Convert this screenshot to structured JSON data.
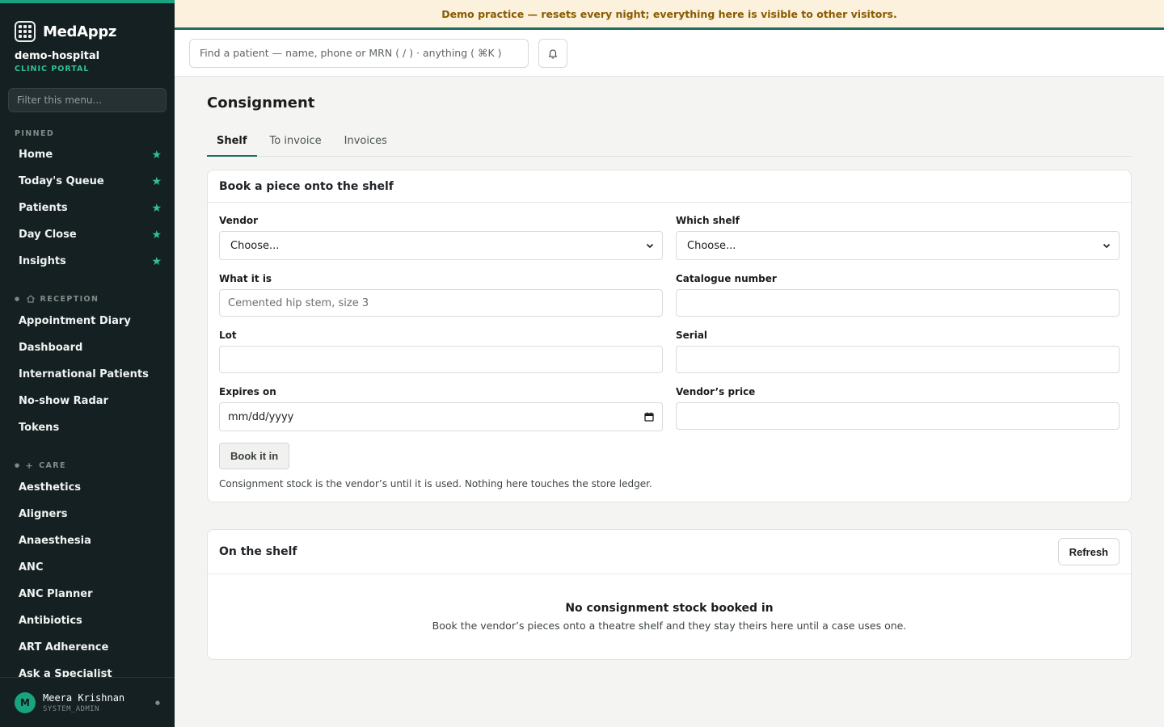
{
  "banner": {
    "text": "Demo practice — resets every night; everything here is visible to other visitors."
  },
  "sidebar": {
    "brand": "MedAppz",
    "tenant_name": "demo-hospital",
    "tenant_sub": "CLINIC PORTAL",
    "filter_placeholder": "Filter this menu...",
    "pinned_label": "PINNED",
    "pinned": [
      {
        "label": "Home"
      },
      {
        "label": "Today's Queue"
      },
      {
        "label": "Patients"
      },
      {
        "label": "Day Close"
      },
      {
        "label": "Insights"
      }
    ],
    "reception_label": "RECEPTION",
    "reception": [
      {
        "label": "Appointment Diary"
      },
      {
        "label": "Dashboard"
      },
      {
        "label": "International Patients"
      },
      {
        "label": "No-show Radar"
      },
      {
        "label": "Tokens"
      }
    ],
    "care_label": "CARE",
    "care": [
      {
        "label": "Aesthetics"
      },
      {
        "label": "Aligners"
      },
      {
        "label": "Anaesthesia"
      },
      {
        "label": "ANC"
      },
      {
        "label": "ANC Planner"
      },
      {
        "label": "Antibiotics"
      },
      {
        "label": "ART Adherence"
      },
      {
        "label": "Ask a Specialist"
      }
    ],
    "user": {
      "initial": "M",
      "name": "Meera Krishnan",
      "role": "SYSTEM_ADMIN"
    }
  },
  "topbar": {
    "search_placeholder": "Find a patient — name, phone or MRN ( / ) · anything ( ⌘K )"
  },
  "page": {
    "title": "Consignment",
    "tabs": [
      {
        "label": "Shelf"
      },
      {
        "label": "To invoice"
      },
      {
        "label": "Invoices"
      }
    ]
  },
  "form": {
    "title": "Book a piece onto the shelf",
    "vendor_label": "Vendor",
    "vendor_value": "Choose...",
    "shelf_label": "Which shelf",
    "shelf_value": "Choose...",
    "what_label": "What it is",
    "what_placeholder": "Cemented hip stem, size 3",
    "catalogue_label": "Catalogue number",
    "lot_label": "Lot",
    "serial_label": "Serial",
    "expires_label": "Expires on",
    "expires_value": "mm/dd/yyyy",
    "price_label": "Vendor’s price",
    "submit_label": "Book it in",
    "help": "Consignment stock is the vendor’s until it is used. Nothing here touches the store ledger."
  },
  "shelf": {
    "title": "On the shelf",
    "refresh_label": "Refresh",
    "empty_title": "No consignment stock booked in",
    "empty_text": "Book the vendor’s pieces onto a theatre shelf and they stay theirs here until a case uses one."
  }
}
